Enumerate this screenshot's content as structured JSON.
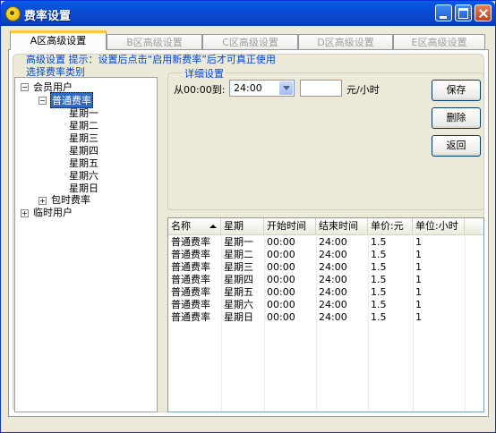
{
  "window": {
    "title": "费率设置"
  },
  "tabs": [
    {
      "label": "A区高级设置",
      "active": true
    },
    {
      "label": "B区高级设置",
      "active": false
    },
    {
      "label": "C区高级设置",
      "active": false
    },
    {
      "label": "D区高级设置",
      "active": false
    },
    {
      "label": "E区高级设置",
      "active": false
    }
  ],
  "hint": "高级设置 提示：设置后点击“启用新费率”后才可真正使用",
  "category_label": "选择费率类别",
  "tree": {
    "member": "会员用户",
    "normal_rate": "普通费率",
    "days": [
      "星期一",
      "星期二",
      "星期三",
      "星期四",
      "星期五",
      "星期六",
      "星期日"
    ],
    "hourly_rate": "包时费率",
    "temp": "临时用户"
  },
  "detail": {
    "group_label": "详细设置",
    "from_label": "从00:00到:",
    "to_time": "24:00",
    "price_value": "",
    "unit_label": "元/小时"
  },
  "buttons": {
    "save": "保存",
    "delete": "删除",
    "back": "返回"
  },
  "table": {
    "columns": [
      "名称",
      "星期",
      "开始时间",
      "结束时间",
      "单价:元",
      "单位:小时"
    ],
    "rows": [
      [
        "普通费率",
        "星期一",
        "00:00",
        "24:00",
        "1.5",
        "1"
      ],
      [
        "普通费率",
        "星期二",
        "00:00",
        "24:00",
        "1.5",
        "1"
      ],
      [
        "普通费率",
        "星期三",
        "00:00",
        "24:00",
        "1.5",
        "1"
      ],
      [
        "普通费率",
        "星期四",
        "00:00",
        "24:00",
        "1.5",
        "1"
      ],
      [
        "普通费率",
        "星期五",
        "00:00",
        "24:00",
        "1.5",
        "1"
      ],
      [
        "普通费率",
        "星期六",
        "00:00",
        "24:00",
        "1.5",
        "1"
      ],
      [
        "普通费率",
        "星期日",
        "00:00",
        "24:00",
        "1.5",
        "1"
      ]
    ]
  },
  "colors": {
    "titlebar": "#0a4bd0",
    "accent_text": "#0046d5",
    "selection": "#316ac5",
    "tab_highlight": "#ffc83c"
  }
}
